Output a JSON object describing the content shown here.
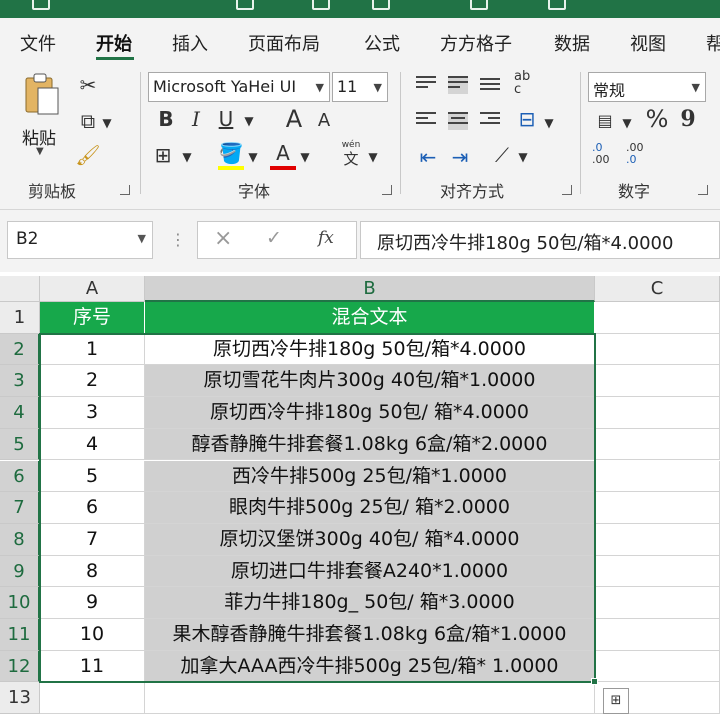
{
  "menu": {
    "tabs": [
      "文件",
      "开始",
      "插入",
      "页面布局",
      "公式",
      "方方格子",
      "数据",
      "视图",
      "帮"
    ],
    "active_tab": "开始"
  },
  "ribbon": {
    "clipboard": {
      "paste_label": "粘贴",
      "group_label": "剪贴板"
    },
    "font": {
      "font_name": "Microsoft YaHei UI",
      "font_size": "11",
      "bold": "B",
      "italic": "I",
      "underline": "U",
      "grow": "A",
      "shrink": "A",
      "wen_label": "wén",
      "wen_char": "文",
      "font_color_letter": "A",
      "group_label": "字体"
    },
    "alignment": {
      "wrap_label": "ab",
      "wrap_sub": "c",
      "group_label": "对齐方式"
    },
    "number": {
      "format": "常规",
      "percent": "%",
      "comma": "9",
      "inc_top": ".0",
      "inc_bottom": ".00",
      "dec_top": ".00",
      "dec_bottom": ".0",
      "group_label": "数字"
    }
  },
  "formula_bar": {
    "name_box": "B2",
    "cancel": "×",
    "confirm": "✓",
    "fx": "fx",
    "content": "原切西冷牛排180g 50包/箱*4.0000"
  },
  "sheet": {
    "columns": [
      "A",
      "B",
      "C"
    ],
    "row_numbers": [
      "1",
      "2",
      "3",
      "4",
      "5",
      "6",
      "7",
      "8",
      "9",
      "10",
      "11",
      "12",
      "13"
    ],
    "header": [
      "序号",
      "混合文本"
    ],
    "rows": [
      [
        "1",
        "原切西冷牛排180g 50包/箱*4.0000"
      ],
      [
        "2",
        "原切雪花牛肉片300g 40包/箱*1.0000"
      ],
      [
        "3",
        "原切西冷牛排180g 50包/ 箱*4.0000"
      ],
      [
        "4",
        "醇香静腌牛排套餐1.08kg 6盒/箱*2.0000"
      ],
      [
        "5",
        "西冷牛排500g 25包/箱*1.0000"
      ],
      [
        "6",
        "眼肉牛排500g 25包/ 箱*2.0000"
      ],
      [
        "7",
        "原切汉堡饼300g 40包/ 箱*4.0000"
      ],
      [
        "8",
        "原切进口牛排套餐A240*1.0000"
      ],
      [
        "9",
        "菲力牛排180g_ 50包/ 箱*3.0000"
      ],
      [
        "10",
        "果木醇香静腌牛排套餐1.08kg 6盒/箱*1.0000"
      ],
      [
        "11",
        "加拿大AAA西冷牛排500g 25包/箱* 1.0000"
      ]
    ]
  },
  "colors": {
    "excel_green": "#217346",
    "header_fill": "#17a84b",
    "selection_fill": "#d0d0d0"
  }
}
